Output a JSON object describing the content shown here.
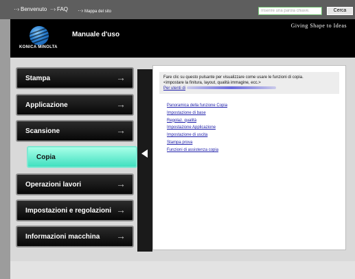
{
  "topbar": {
    "home": "Benvenuto",
    "faq": "FAQ",
    "sitemap": "Mappa del sito",
    "search_placeholder": "Inserire una parola chiave.",
    "search_button": "Cerca"
  },
  "header": {
    "brand": "KONICA MINOLTA",
    "title": "Manuale d'uso",
    "tagline": "Giving Shape to Ideas"
  },
  "menu": {
    "items": [
      {
        "label": "Stampa"
      },
      {
        "label": "Applicazione"
      },
      {
        "label": "Scansione"
      },
      {
        "label": "Copia"
      },
      {
        "label": "Operazioni lavori"
      },
      {
        "label": "Impostazioni e regolazioni"
      },
      {
        "label": "Informazioni macchina"
      }
    ],
    "active": "Copia"
  },
  "content": {
    "intro_line1": "Fare clic su questo pulsante per visualizzare come usare le funzioni di copia.",
    "intro_line2": "<impostare la finitura, layout, qualità immagine, ecc.>",
    "intro_link": "Per utenti di",
    "links": [
      "Panoramica della funzione Copia",
      "Impostazione di base",
      "Regolaz. qualità",
      "Impostazione Applicazione",
      "Impostazione di uscita",
      "Stampa prova",
      "Funzioni di assistenza copia"
    ]
  }
}
